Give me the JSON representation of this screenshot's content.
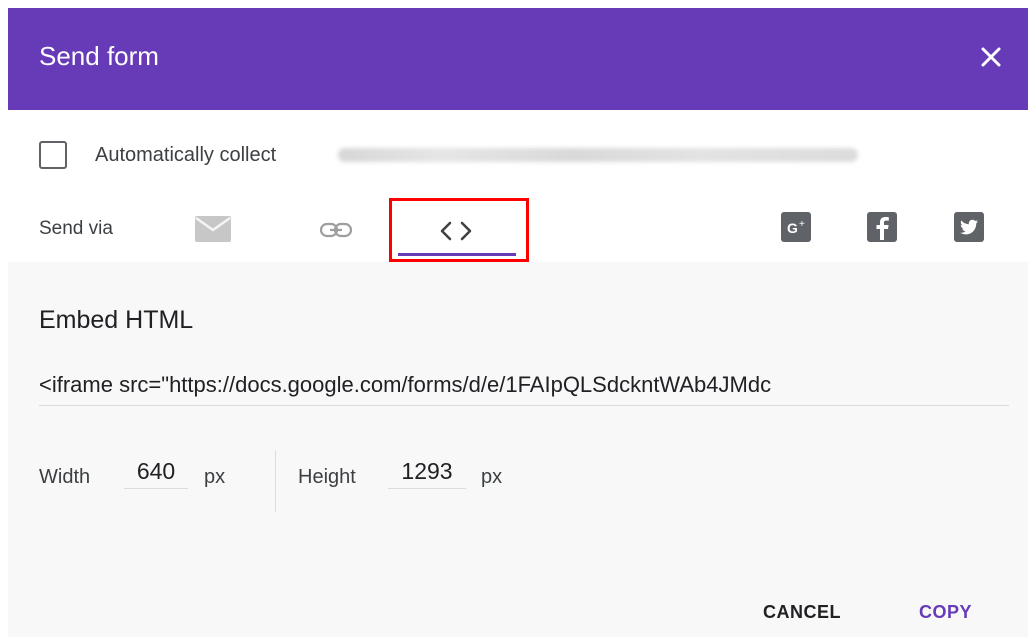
{
  "dialog": {
    "title": "Send form",
    "close_icon": "close-icon"
  },
  "collect": {
    "label": "Automatically collect",
    "checked": false,
    "redacted_text": "respondent's email address (blurred)"
  },
  "send_via": {
    "label": "Send via",
    "icons": [
      "email-icon",
      "link-icon",
      "embed-code-icon"
    ],
    "active": "embed-code-icon",
    "social": [
      "google-plus-icon",
      "facebook-icon",
      "twitter-icon"
    ],
    "highlight_color": "#ff0000"
  },
  "embed": {
    "title": "Embed HTML",
    "code": "<iframe src=\"https://docs.google.com/forms/d/e/1FAIpQLSdckntWAb4JMdc",
    "width_label": "Width",
    "width_value": "640",
    "width_unit": "px",
    "height_label": "Height",
    "height_value": "1293",
    "height_unit": "px"
  },
  "actions": {
    "cancel": "CANCEL",
    "copy": "COPY"
  },
  "colors": {
    "header": "#673ab7",
    "accent": "#673ab7",
    "panel": "#f8f8f8"
  }
}
